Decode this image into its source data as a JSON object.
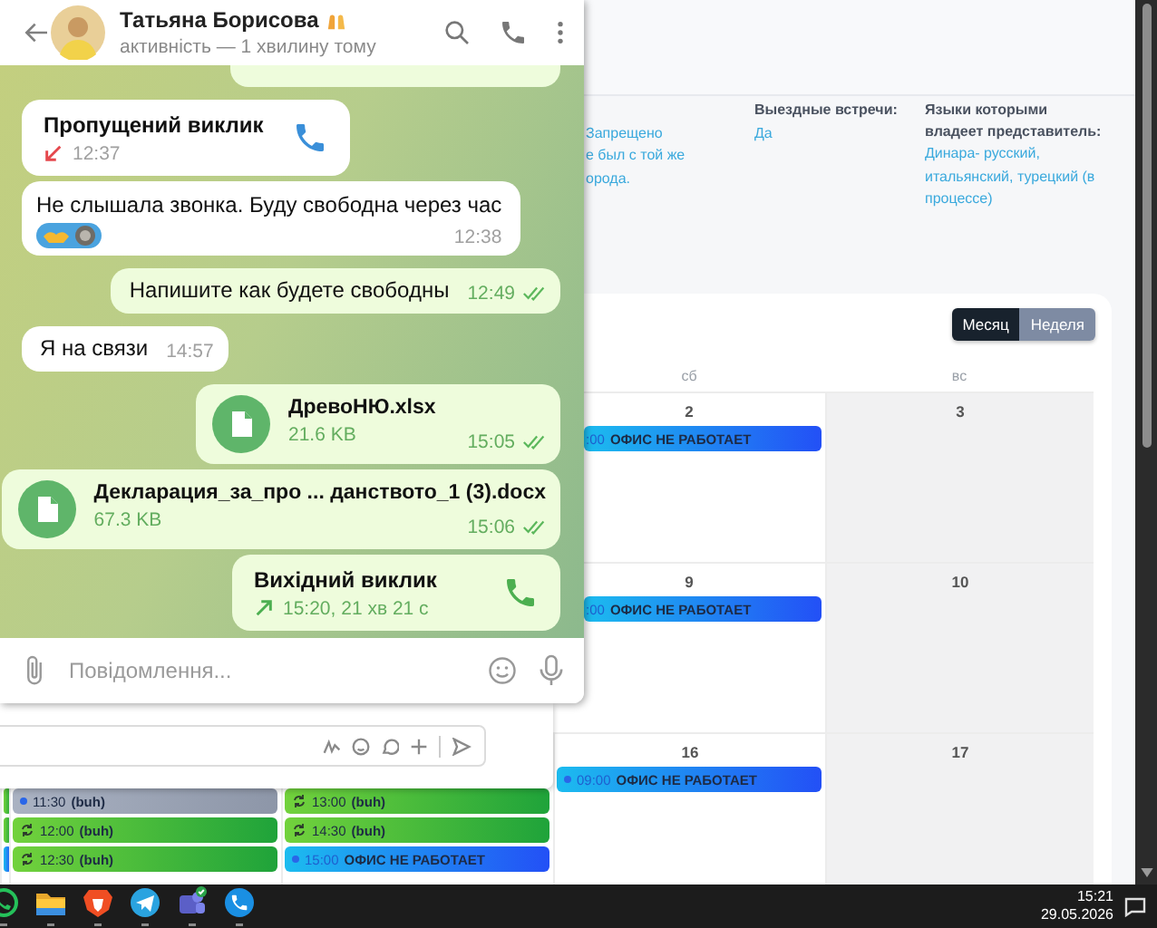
{
  "chat": {
    "contact": {
      "name": "Татьяна Борисова",
      "status": "активність — 1 хвилину тому"
    },
    "messages": [
      {
        "kind": "clipped",
        "outgoing": true
      },
      {
        "kind": "call",
        "outgoing": false,
        "title": "Пропущений виклик",
        "missed": true,
        "time": "12:37"
      },
      {
        "kind": "text",
        "outgoing": false,
        "text": "Не слышала звонка. Буду свободна через час",
        "reactions": true,
        "time": "12:38"
      },
      {
        "kind": "text",
        "outgoing": true,
        "text": "Напишите как будете свободны",
        "time": "12:49",
        "read": true
      },
      {
        "kind": "text",
        "outgoing": false,
        "text": "Я на связи",
        "time": "14:57"
      },
      {
        "kind": "file",
        "outgoing": true,
        "name": "ДревоНЮ.xlsx",
        "size": "21.6 KB",
        "time": "15:05",
        "read": true
      },
      {
        "kind": "file",
        "outgoing": true,
        "name": "Декларация_за_про ... данството_1 (3).docx",
        "size": "67.3 KB",
        "time": "15:06",
        "read": true
      },
      {
        "kind": "call",
        "outgoing": true,
        "title": "Вихідний виклик",
        "missed": false,
        "time": "15:20, 21 хв 21 с"
      }
    ],
    "composer": {
      "placeholder": "Повідомлення..."
    }
  },
  "page": {
    "details": [
      {
        "lines": [
          "Запрещено",
          "е был с той же",
          "орода."
        ]
      },
      {
        "label": "Выездные встречи:",
        "lines": [
          "Да"
        ]
      },
      {
        "label": "Языки которыми владеет представитель:",
        "lines": [
          "Динара- русский, итальянский, турецкий (в процессе)"
        ]
      }
    ],
    "calendar": {
      "view_toggle": [
        {
          "label": "Месяц",
          "selected": true
        },
        {
          "label": "Неделя",
          "selected": false
        }
      ],
      "weekdays": [
        "сб",
        "вс"
      ],
      "weeks": [
        {
          "days": [
            {
              "number": "2",
              "weekend": false,
              "events": [
                {
                  "kind": "office",
                  "time": ":00",
                  "title": "ОФИС НЕ РАБОТАЕТ",
                  "dot": false
                }
              ]
            },
            {
              "number": "3",
              "weekend": true
            }
          ]
        },
        {
          "days": [
            {
              "number": "9",
              "weekend": false,
              "events": [
                {
                  "kind": "office",
                  "time": ":00",
                  "title": "ОФИС НЕ РАБОТАЕТ",
                  "dot": false
                }
              ]
            },
            {
              "number": "10",
              "weekend": true
            }
          ]
        },
        {
          "days": [
            {
              "weekend": false,
              "events": [
                {
                  "kind": "recurring"
                },
                {
                  "kind": "recurring"
                },
                {
                  "kind": "office"
                }
              ]
            },
            {
              "weekend": false,
              "events": [
                {
                  "kind": "past",
                  "time": "11:30",
                  "title": "(buh)",
                  "dot": true
                },
                {
                  "kind": "recurring",
                  "time": "12:00",
                  "title": "(buh)"
                },
                {
                  "kind": "recurring",
                  "time": "12:30",
                  "title": "(buh)"
                }
              ]
            },
            {
              "weekend": false,
              "events": [
                {
                  "kind": "recurring",
                  "time": "13:00",
                  "title": "(buh)"
                },
                {
                  "kind": "recurring",
                  "time": "14:30",
                  "title": "(buh)"
                },
                {
                  "kind": "office",
                  "time": "15:00",
                  "title": "ОФИС НЕ РАБОТАЕТ",
                  "dot": true
                }
              ]
            },
            {
              "number": "16",
              "weekend": false,
              "events": [
                {
                  "kind": "office",
                  "time": "09:00",
                  "title": "ОФИС НЕ РАБОТАЕТ",
                  "dot": true
                }
              ]
            },
            {
              "number": "17",
              "weekend": true
            }
          ]
        }
      ]
    }
  },
  "taskbar": {
    "time": "15:21",
    "date": "29.05.2026"
  }
}
